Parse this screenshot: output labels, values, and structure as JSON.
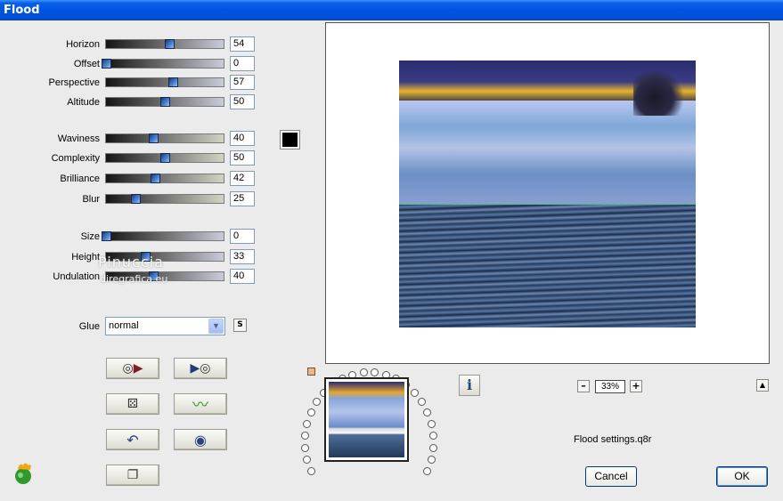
{
  "window": {
    "title": "Flood"
  },
  "sliders": [
    {
      "label": "Horizon",
      "value": "54",
      "level": 54
    },
    {
      "label": "Offset",
      "value": "0",
      "level": 0
    },
    {
      "label": "Perspective",
      "value": "57",
      "level": 57
    },
    {
      "label": "Altitude",
      "value": "50",
      "level": 50
    },
    {
      "label": "Waviness",
      "value": "40",
      "level": 40
    },
    {
      "label": "Complexity",
      "value": "50",
      "level": 50
    },
    {
      "label": "Brilliance",
      "value": "42",
      "level": 42
    },
    {
      "label": "Blur",
      "value": "25",
      "level": 25
    },
    {
      "label": "Size",
      "value": "0",
      "level": 0
    },
    {
      "label": "Height",
      "value": "33",
      "level": 33
    },
    {
      "label": "Undulation",
      "value": "40",
      "level": 40
    }
  ],
  "color": {
    "swatch": "#000000"
  },
  "watermark": {
    "name": "Pinuccia",
    "site": "diregrafica.eu"
  },
  "glue": {
    "label": "Glue",
    "selected": "normal",
    "button": "S"
  },
  "icons": {
    "prev_preset": "load-previous-icon",
    "next_preset": "load-next-icon",
    "randomize": "dice-icon",
    "reset": "wave-icon",
    "undo": "undo-icon",
    "default": "ring-icon",
    "copy": "copy-icon"
  },
  "preview": {
    "zoom": "33%"
  },
  "info_label": "i",
  "settings_file": "Flood settings.q8r",
  "buttons": {
    "cancel": "Cancel",
    "ok": "OK"
  }
}
